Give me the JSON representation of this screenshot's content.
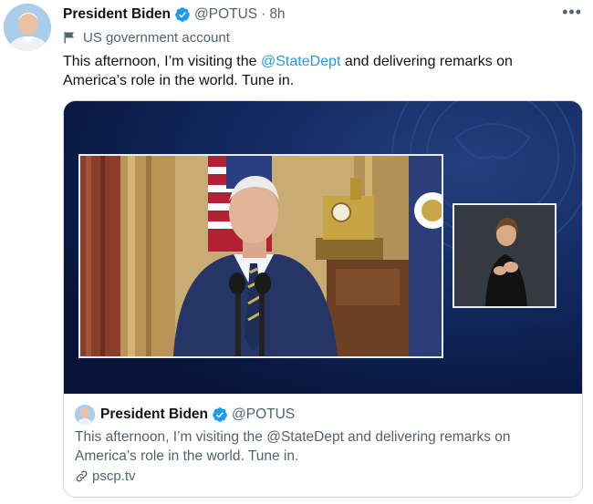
{
  "tweet": {
    "author_name": "President Biden",
    "handle": "@POTUS",
    "separator": "·",
    "time": "8h",
    "account_label": "US government account",
    "text_before": "This afternoon, I’m visiting the ",
    "mention": "@StateDept",
    "text_after": " and delivering remarks on America’s role in the world. Tune in.",
    "more_icon": "more-options-icon"
  },
  "quote_card": {
    "author_name": "President Biden",
    "handle": "@POTUS",
    "text": "This afternoon, I’m visiting the @StateDept and delivering remarks on America’s role in the world. Tune in.",
    "link_text": "pscp.tv"
  },
  "colors": {
    "link": "#1d9bf0",
    "verified": "#1d9bf0",
    "muted": "#536471",
    "media_background": "#0b1a46"
  }
}
